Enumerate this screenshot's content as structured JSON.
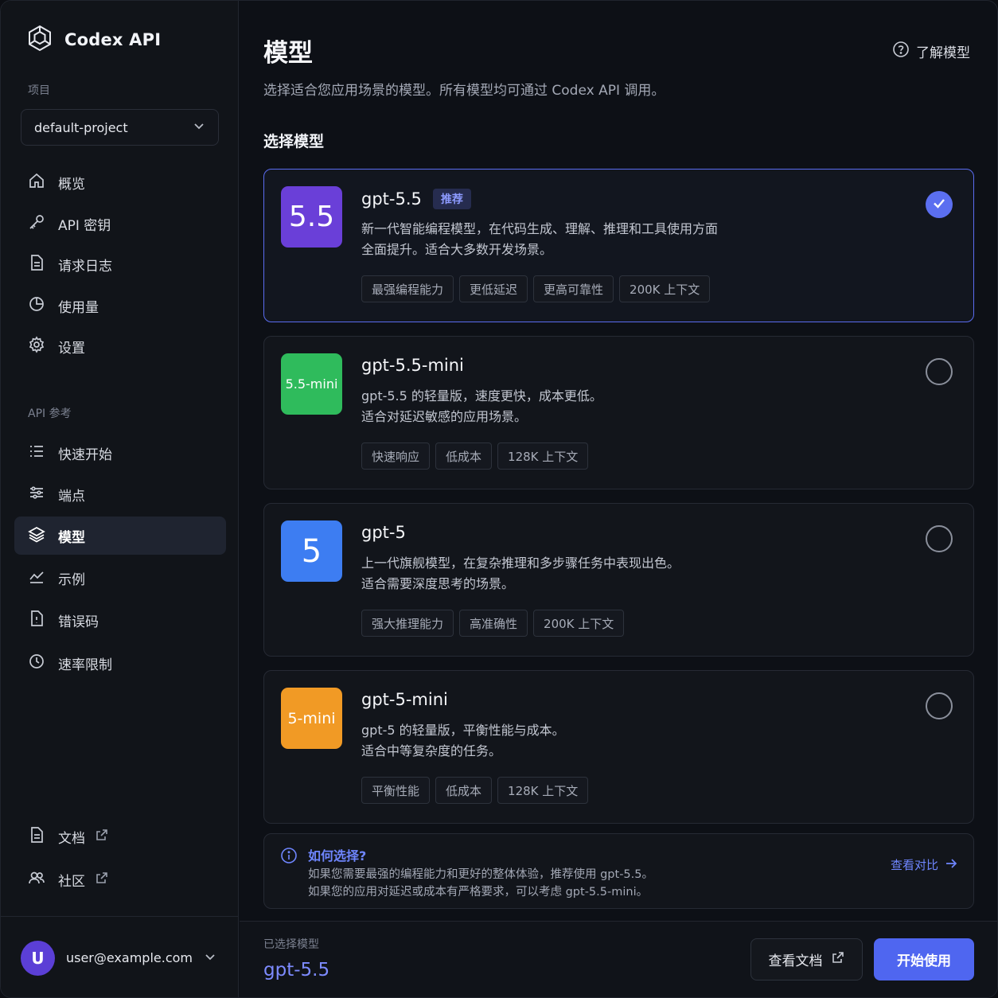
{
  "app": {
    "name": "Codex API"
  },
  "sidebar": {
    "project_label": "项目",
    "project_value": "default-project",
    "nav": [
      {
        "label": "概览",
        "icon": "home-icon"
      },
      {
        "label": "API 密钥",
        "icon": "key-icon"
      },
      {
        "label": "请求日志",
        "icon": "document-icon"
      },
      {
        "label": "使用量",
        "icon": "pie-chart-icon"
      },
      {
        "label": "设置",
        "icon": "gear-icon"
      }
    ],
    "api_ref_label": "API 参考",
    "api_nav": [
      {
        "label": "快速开始",
        "icon": "list-icon"
      },
      {
        "label": "端点",
        "icon": "sliders-icon"
      },
      {
        "label": "模型",
        "icon": "layers-icon",
        "active": true
      },
      {
        "label": "示例",
        "icon": "line-chart-icon"
      },
      {
        "label": "错误码",
        "icon": "error-doc-icon"
      },
      {
        "label": "速率限制",
        "icon": "clock-icon"
      }
    ],
    "bottom_links": [
      {
        "label": "文档",
        "icon": "document-icon"
      },
      {
        "label": "社区",
        "icon": "users-icon"
      }
    ],
    "user": {
      "initial": "U",
      "email": "user@example.com",
      "avatar_color": "#5b3fd6"
    }
  },
  "main": {
    "title": "模型",
    "learn_link": "了解模型",
    "subtitle": "选择适合您应用场景的模型。所有模型均可通过 Codex API 调用。",
    "select_heading": "选择模型",
    "models": [
      {
        "badge": "5.5",
        "badge_color": "#6a3fd8",
        "name": "gpt-5.5",
        "recommended": "推荐",
        "desc": [
          "新一代智能编程模型，在代码生成、理解、推理和工具使用方面",
          "全面提升。适合大多数开发场景。"
        ],
        "tags": [
          "最强编程能力",
          "更低延迟",
          "更高可靠性",
          "200K 上下文"
        ],
        "selected": true
      },
      {
        "badge": "5.5-mini",
        "badge_color": "#2fbb5c",
        "name": "gpt-5.5-mini",
        "desc": [
          "gpt-5.5 的轻量版，速度更快，成本更低。",
          "适合对延迟敏感的应用场景。"
        ],
        "tags": [
          "快速响应",
          "低成本",
          "128K 上下文"
        ],
        "selected": false
      },
      {
        "badge": "5",
        "badge_color": "#3d7df2",
        "name": "gpt-5",
        "desc": [
          "上一代旗舰模型，在复杂推理和多步骤任务中表现出色。",
          "适合需要深度思考的场景。"
        ],
        "tags": [
          "强大推理能力",
          "高准确性",
          "200K 上下文"
        ],
        "selected": false
      },
      {
        "badge": "5-mini",
        "badge_color": "#f19a25",
        "name": "gpt-5-mini",
        "desc": [
          "gpt-5 的轻量版，平衡性能与成本。",
          "适合中等复杂度的任务。"
        ],
        "tags": [
          "平衡性能",
          "低成本",
          "128K 上下文"
        ],
        "selected": false
      }
    ],
    "info": {
      "title": "如何选择?",
      "line1": "如果您需要最强的编程能力和更好的整体体验，推荐使用 gpt-5.5。",
      "line2": "如果您的应用对延迟或成本有严格要求，可以考虑 gpt-5.5-mini。",
      "compare": "查看对比"
    },
    "footer": {
      "label": "已选择模型",
      "selected_model": "gpt-5.5",
      "docs_button": "查看文档",
      "start_button": "开始使用"
    }
  },
  "colors": {
    "accent": "#5b6ff0",
    "link": "#6f86ff"
  }
}
